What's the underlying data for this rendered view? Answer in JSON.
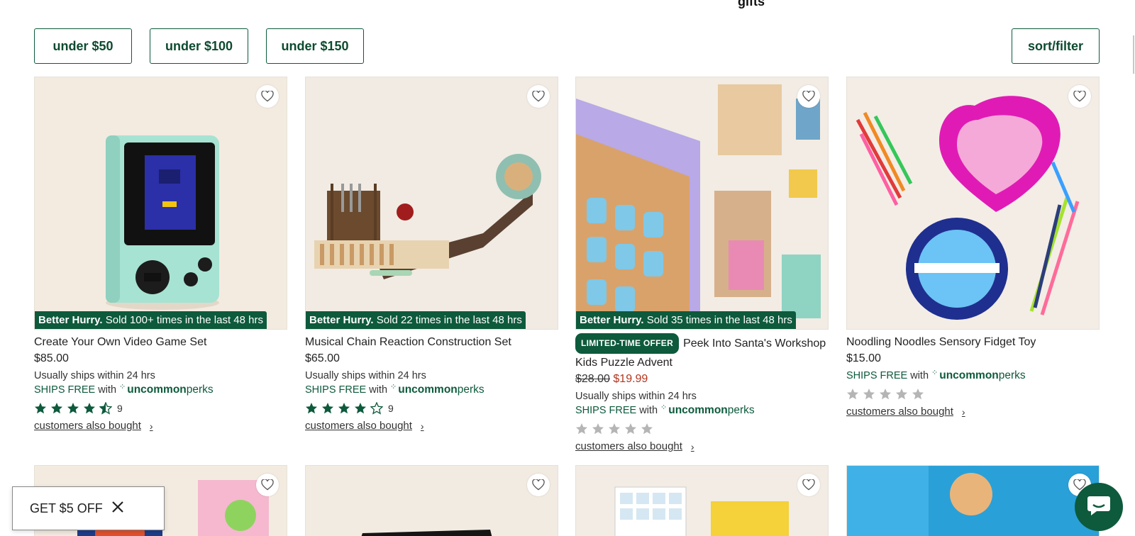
{
  "page": {
    "heading_fragment": "gifts"
  },
  "filters": [
    {
      "label": "under $50"
    },
    {
      "label": "under $100"
    },
    {
      "label": "under $150"
    }
  ],
  "sort_filter_label": "sort/filter",
  "products": [
    {
      "hurry_bold": "Better Hurry.",
      "hurry_text": "Sold 100+ times in the last 48 hrs",
      "title": "Create Your Own Video Game Set",
      "price": "$85.00",
      "ships": "Usually ships within 24 hrs",
      "ships_free": "SHIPS FREE",
      "with": "with",
      "perks_uncommon": "uncommon",
      "perks_word": "perks",
      "rating": 4.5,
      "review_count": "9",
      "also_bought": "customers also bought"
    },
    {
      "hurry_bold": "Better Hurry.",
      "hurry_text": "Sold 22 times in the last 48 hrs",
      "title": "Musical Chain Reaction Construction Set",
      "price": "$65.00",
      "ships": "Usually ships within 24 hrs",
      "ships_free": "SHIPS FREE",
      "with": "with",
      "perks_uncommon": "uncommon",
      "perks_word": "perks",
      "rating": 4,
      "review_count": "9",
      "also_bought": "customers also bought"
    },
    {
      "hurry_bold": "Better Hurry.",
      "hurry_text": "Sold 35 times in the last 48 hrs",
      "badge": "LIMITED-TIME OFFER",
      "title": "Peek Into Santa's Workshop Kids Puzzle Advent",
      "original_price": "$28.00",
      "sale_price": "$19.99",
      "ships": "Usually ships within 24 hrs",
      "ships_free": "SHIPS FREE",
      "with": "with",
      "perks_uncommon": "uncommon",
      "perks_word": "perks",
      "rating": 0,
      "also_bought": "customers also bought"
    },
    {
      "title": "Noodling Noodles Sensory Fidget Toy",
      "price": "$15.00",
      "ships_free": "SHIPS FREE",
      "with": "with",
      "perks_uncommon": "uncommon",
      "perks_word": "perks",
      "rating": 0,
      "also_bought": "customers also bought"
    }
  ],
  "promo": {
    "label": "GET $5 OFF"
  },
  "colors": {
    "brand_green": "#0d5a3c",
    "sale_red": "#b3361f",
    "star_empty": "#b5b5b5"
  },
  "icons": {
    "favorite": "heart-icon",
    "close": "close-icon",
    "chat": "chat-icon",
    "chevron": "chevron-right-icon"
  }
}
